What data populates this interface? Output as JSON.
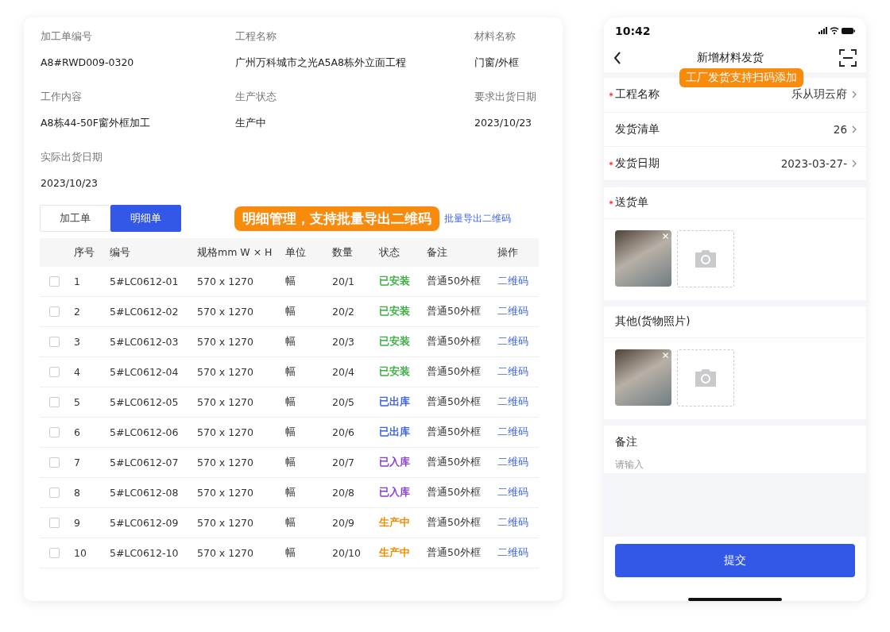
{
  "order_info": [
    {
      "label": "加工单编号",
      "value": "A8#RWD009-0320"
    },
    {
      "label": "工程名称",
      "value": "广州万科城市之光A5A8栋外立面工程"
    },
    {
      "label": "材料名称",
      "value": "门窗/外框"
    },
    {
      "label": "工作内容",
      "value": "A8栋44-50F窗外框加工"
    },
    {
      "label": "生产状态",
      "value": "生产中"
    },
    {
      "label": "要求出货日期",
      "value": "2023/10/23"
    },
    {
      "label": "实际出货日期",
      "value": "2023/10/23"
    }
  ],
  "tabs": [
    {
      "label": "加工单",
      "selected": false
    },
    {
      "label": "明细单",
      "selected": true
    }
  ],
  "detail_callout": "明细管理，支持批量导出二维码",
  "export_link": "批量导出二维码",
  "table": {
    "columns": [
      "序号",
      "编号",
      "规格mm  W × H",
      "单位",
      "数量",
      "状态",
      "备注",
      "操作"
    ],
    "rows": [
      {
        "checked": false,
        "no": "1",
        "code": "5#LC0612-01",
        "size": "570 x 1270",
        "unit": "幅",
        "qty": "20/1",
        "status": "已安装",
        "color": "#3cb043",
        "note": "普通50外框",
        "action": "二维码"
      },
      {
        "checked": false,
        "no": "2",
        "code": "5#LC0612-02",
        "size": "570 x 1270",
        "unit": "幅",
        "qty": "20/2",
        "status": "已安装",
        "color": "#3cb043",
        "note": "普通50外框",
        "action": "二维码"
      },
      {
        "checked": false,
        "no": "3",
        "code": "5#LC0612-03",
        "size": "570 x 1270",
        "unit": "幅",
        "qty": "20/3",
        "status": "已安装",
        "color": "#3cb043",
        "note": "普通50外框",
        "action": "二维码"
      },
      {
        "checked": false,
        "no": "4",
        "code": "5#LC0612-04",
        "size": "570 x 1270",
        "unit": "幅",
        "qty": "20/4",
        "status": "已安装",
        "color": "#3cb043",
        "note": "普通50外框",
        "action": "二维码"
      },
      {
        "checked": false,
        "no": "5",
        "code": "5#LC0612-05",
        "size": "570 x 1270",
        "unit": "幅",
        "qty": "20/5",
        "status": "已出库",
        "color": "#3d63e6",
        "note": "普通50外框",
        "action": "二维码"
      },
      {
        "checked": false,
        "no": "6",
        "code": "5#LC0612-06",
        "size": "570 x 1270",
        "unit": "幅",
        "qty": "20/6",
        "status": "已出库",
        "color": "#3d63e6",
        "note": "普通50外框",
        "action": "二维码"
      },
      {
        "checked": false,
        "no": "7",
        "code": "5#LC0612-07",
        "size": "570 x 1270",
        "unit": "幅",
        "qty": "20/7",
        "status": "已入库",
        "color": "#8a3fd1",
        "note": "普通50外框",
        "action": "二维码"
      },
      {
        "checked": false,
        "no": "8",
        "code": "5#LC0612-08",
        "size": "570 x 1270",
        "unit": "幅",
        "qty": "20/8",
        "status": "已入库",
        "color": "#8a3fd1",
        "note": "普通50外框",
        "action": "二维码"
      },
      {
        "checked": false,
        "no": "9",
        "code": "5#LC0612-09",
        "size": "570 x 1270",
        "unit": "幅",
        "qty": "20/9",
        "status": "生产中",
        "color": "#f08c00",
        "note": "普通50外框",
        "action": "二维码"
      },
      {
        "checked": false,
        "no": "10",
        "code": "5#LC0612-10",
        "size": "570 x 1270",
        "unit": "幅",
        "qty": "20/10",
        "status": "生产中",
        "color": "#f08c00",
        "note": "普通50外框",
        "action": "二维码"
      }
    ]
  },
  "phone": {
    "time": "10:42",
    "title": "新增材料发货",
    "callout": "工厂发货支持扫码添加",
    "fields": [
      {
        "label": "工程名称",
        "value": "乐从玥云府",
        "required": true
      },
      {
        "label": "发货清单",
        "value": "26",
        "required": false
      },
      {
        "label": "发货日期",
        "value": "2023-03-27-",
        "required": true
      }
    ],
    "sections": [
      {
        "title": "送货单",
        "required": true
      },
      {
        "title": "其他(货物照片)",
        "required": false
      }
    ],
    "remark": {
      "title": "备注",
      "placeholder": "请输入"
    },
    "submit": "提交"
  }
}
